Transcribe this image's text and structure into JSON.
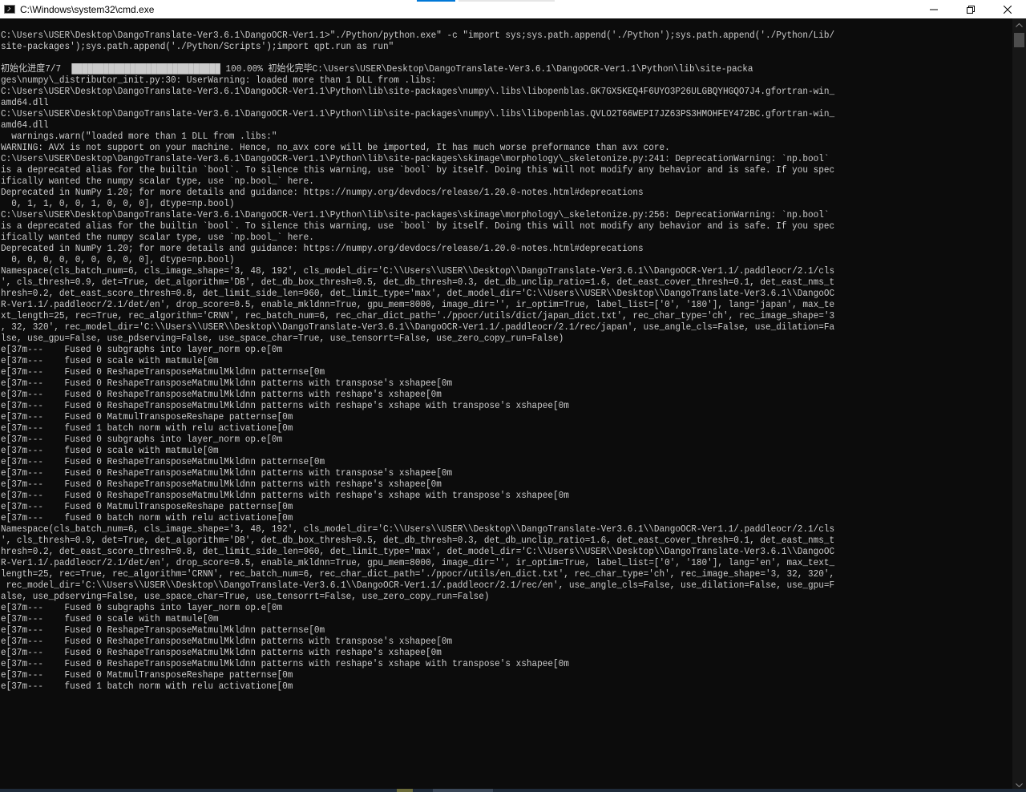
{
  "window": {
    "title": "C:\\Windows\\system32\\cmd.exe",
    "icon": "cmd-icon"
  },
  "controls": {
    "minimize_icon": "minimize-icon",
    "restore_icon": "restore-icon",
    "close_icon": "close-icon"
  },
  "console": {
    "text_color": "#cccccc",
    "background_color": "#0c0c0c",
    "lines": [
      "C:\\Users\\USER\\Desktop\\DangoTranslate-Ver3.6.1\\DangoOCR-Ver1.1>\"./Python/python.exe\" -c \"import sys;sys.path.append('./Python');sys.path.append('./Python/Lib/",
      "site-packages');sys.path.append('./Python/Scripts');import qpt.run as run\"",
      "",
      "初始化进度7/7  ████████████████████████████ 100.00% 初始化完毕C:\\Users\\USER\\Desktop\\DangoTranslate-Ver3.6.1\\DangoOCR-Ver1.1\\Python\\lib\\site-packa",
      "ges\\numpy\\_distributor_init.py:30: UserWarning: loaded more than 1 DLL from .libs:",
      "C:\\Users\\USER\\Desktop\\DangoTranslate-Ver3.6.1\\DangoOCR-Ver1.1\\Python\\lib\\site-packages\\numpy\\.libs\\libopenblas.GK7GX5KEQ4F6UYO3P26ULGBQYHGQO7J4.gfortran-win_",
      "amd64.dll",
      "C:\\Users\\USER\\Desktop\\DangoTranslate-Ver3.6.1\\DangoOCR-Ver1.1\\Python\\lib\\site-packages\\numpy\\.libs\\libopenblas.QVLO2T66WEPI7JZ63PS3HMOHFEY472BC.gfortran-win_",
      "amd64.dll",
      "  warnings.warn(\"loaded more than 1 DLL from .libs:\"",
      "WARNING: AVX is not support on your machine. Hence, no_avx core will be imported, It has much worse preformance than avx core.",
      "C:\\Users\\USER\\Desktop\\DangoTranslate-Ver3.6.1\\DangoOCR-Ver1.1\\Python\\lib\\site-packages\\skimage\\morphology\\_skeletonize.py:241: DeprecationWarning: `np.bool`",
      "is a deprecated alias for the builtin `bool`. To silence this warning, use `bool` by itself. Doing this will not modify any behavior and is safe. If you spec",
      "ifically wanted the numpy scalar type, use `np.bool_` here.",
      "Deprecated in NumPy 1.20; for more details and guidance: https://numpy.org/devdocs/release/1.20.0-notes.html#deprecations",
      "  0, 1, 1, 0, 0, 1, 0, 0, 0], dtype=np.bool)",
      "C:\\Users\\USER\\Desktop\\DangoTranslate-Ver3.6.1\\DangoOCR-Ver1.1\\Python\\lib\\site-packages\\skimage\\morphology\\_skeletonize.py:256: DeprecationWarning: `np.bool`",
      "is a deprecated alias for the builtin `bool`. To silence this warning, use `bool` by itself. Doing this will not modify any behavior and is safe. If you spec",
      "ifically wanted the numpy scalar type, use `np.bool_` here.",
      "Deprecated in NumPy 1.20; for more details and guidance: https://numpy.org/devdocs/release/1.20.0-notes.html#deprecations",
      "  0, 0, 0, 0, 0, 0, 0, 0, 0], dtype=np.bool)",
      "Namespace(cls_batch_num=6, cls_image_shape='3, 48, 192', cls_model_dir='C:\\\\Users\\\\USER\\\\Desktop\\\\DangoTranslate-Ver3.6.1\\\\DangoOCR-Ver1.1/.paddleocr/2.1/cls",
      "', cls_thresh=0.9, det=True, det_algorithm='DB', det_db_box_thresh=0.5, det_db_thresh=0.3, det_db_unclip_ratio=1.6, det_east_cover_thresh=0.1, det_east_nms_t",
      "hresh=0.2, det_east_score_thresh=0.8, det_limit_side_len=960, det_limit_type='max', det_model_dir='C:\\\\Users\\\\USER\\\\Desktop\\\\DangoTranslate-Ver3.6.1\\\\DangoOC",
      "R-Ver1.1/.paddleocr/2.1/det/en', drop_score=0.5, enable_mkldnn=True, gpu_mem=8000, image_dir='', ir_optim=True, label_list=['0', '180'], lang='japan', max_te",
      "xt_length=25, rec=True, rec_algorithm='CRNN', rec_batch_num=6, rec_char_dict_path='./ppocr/utils/dict/japan_dict.txt', rec_char_type='ch', rec_image_shape='3",
      ", 32, 320', rec_model_dir='C:\\\\Users\\\\USER\\\\Desktop\\\\DangoTranslate-Ver3.6.1\\\\DangoOCR-Ver1.1/.paddleocr/2.1/rec/japan', use_angle_cls=False, use_dilation=Fa",
      "lse, use_gpu=False, use_pdserving=False, use_space_char=True, use_tensorrt=False, use_zero_copy_run=False)",
      "e[37m---    Fused 0 subgraphs into layer_norm op.e[0m",
      "e[37m---    fused 0 scale with matmule[0m",
      "e[37m---    Fused 0 ReshapeTransposeMatmulMkldnn patternse[0m",
      "e[37m---    Fused 0 ReshapeTransposeMatmulMkldnn patterns with transpose's xshapee[0m",
      "e[37m---    Fused 0 ReshapeTransposeMatmulMkldnn patterns with reshape's xshapee[0m",
      "e[37m---    Fused 0 ReshapeTransposeMatmulMkldnn patterns with reshape's xshape with transpose's xshapee[0m",
      "e[37m---    Fused 0 MatmulTransposeReshape patternse[0m",
      "e[37m---    fused 1 batch norm with relu activatione[0m",
      "e[37m---    Fused 0 subgraphs into layer_norm op.e[0m",
      "e[37m---    fused 0 scale with matmule[0m",
      "e[37m---    Fused 0 ReshapeTransposeMatmulMkldnn patternse[0m",
      "e[37m---    Fused 0 ReshapeTransposeMatmulMkldnn patterns with transpose's xshapee[0m",
      "e[37m---    Fused 0 ReshapeTransposeMatmulMkldnn patterns with reshape's xshapee[0m",
      "e[37m---    Fused 0 ReshapeTransposeMatmulMkldnn patterns with reshape's xshape with transpose's xshapee[0m",
      "e[37m---    Fused 0 MatmulTransposeReshape patternse[0m",
      "e[37m---    fused 0 batch norm with relu activatione[0m",
      "Namespace(cls_batch_num=6, cls_image_shape='3, 48, 192', cls_model_dir='C:\\\\Users\\\\USER\\\\Desktop\\\\DangoTranslate-Ver3.6.1\\\\DangoOCR-Ver1.1/.paddleocr/2.1/cls",
      "', cls_thresh=0.9, det=True, det_algorithm='DB', det_db_box_thresh=0.5, det_db_thresh=0.3, det_db_unclip_ratio=1.6, det_east_cover_thresh=0.1, det_east_nms_t",
      "hresh=0.2, det_east_score_thresh=0.8, det_limit_side_len=960, det_limit_type='max', det_model_dir='C:\\\\Users\\\\USER\\\\Desktop\\\\DangoTranslate-Ver3.6.1\\\\DangoOC",
      "R-Ver1.1/.paddleocr/2.1/det/en', drop_score=0.5, enable_mkldnn=True, gpu_mem=8000, image_dir='', ir_optim=True, label_list=['0', '180'], lang='en', max_text_",
      "length=25, rec=True, rec_algorithm='CRNN', rec_batch_num=6, rec_char_dict_path='./ppocr/utils/en_dict.txt', rec_char_type='ch', rec_image_shape='3, 32, 320',",
      " rec_model_dir='C:\\\\Users\\\\USER\\\\Desktop\\\\DangoTranslate-Ver3.6.1\\\\DangoOCR-Ver1.1/.paddleocr/2.1/rec/en', use_angle_cls=False, use_dilation=False, use_gpu=F",
      "alse, use_pdserving=False, use_space_char=True, use_tensorrt=False, use_zero_copy_run=False)",
      "e[37m---    Fused 0 subgraphs into layer_norm op.e[0m",
      "e[37m---    fused 0 scale with matmule[0m",
      "e[37m---    Fused 0 ReshapeTransposeMatmulMkldnn patternse[0m",
      "e[37m---    Fused 0 ReshapeTransposeMatmulMkldnn patterns with transpose's xshapee[0m",
      "e[37m---    Fused 0 ReshapeTransposeMatmulMkldnn patterns with reshape's xshapee[0m",
      "e[37m---    Fused 0 ReshapeTransposeMatmulMkldnn patterns with reshape's xshape with transpose's xshapee[0m",
      "e[37m---    Fused 0 MatmulTransposeReshape patternse[0m",
      "e[37m---    fused 1 batch norm with relu activatione[0m"
    ]
  },
  "scrollbar": {
    "up_icon": "scroll-up-arrow-icon",
    "down_icon": "scroll-down-arrow-icon"
  }
}
